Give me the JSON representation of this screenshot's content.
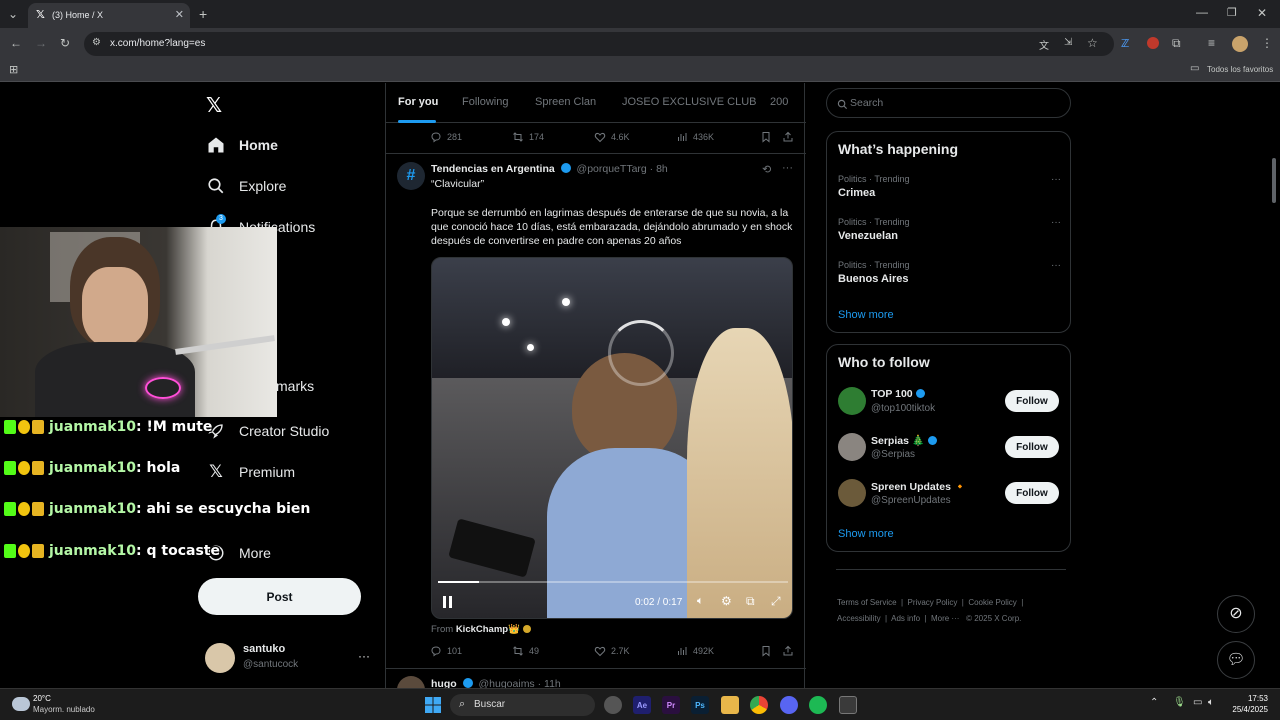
{
  "browser": {
    "tab_title": "(3) Home / X",
    "url": "x.com/home?lang=es",
    "bookmarks_label": "Todos los favoritos"
  },
  "nav": {
    "home": "Home",
    "explore": "Explore",
    "notifications": "Notifications",
    "bookmarks_partial": "marks",
    "creator_studio": "Creator Studio",
    "premium": "Premium",
    "more": "More",
    "post": "Post",
    "notif_badge": "3"
  },
  "account": {
    "name": "santuko",
    "handle": "@santucock"
  },
  "feed_tabs": [
    "For you",
    "Following",
    "Spreen Clan",
    "JOSEO EXCLUSIVE CLUB",
    "200"
  ],
  "prev_post_actions": {
    "replies": "281",
    "reposts": "174",
    "likes": "4.6K",
    "views": "436K"
  },
  "post": {
    "author": "Tendencias en Argentina",
    "handle": "@porqueTTarg",
    "time": "· 8h",
    "subtitle": "“Clavicular”",
    "text": "Porque se derrumbó en lagrimas después de enterarse de que su novia, a la que conoció hace 10 días, está embarazada, dejándolo abrumado y en shock después de convertirse en padre con apenas 20 años",
    "video_time": "0:02 / 0:17",
    "from_label": "From",
    "from_source": "KickChamp👑",
    "replies": "101",
    "reposts": "49",
    "likes": "2.7K",
    "views": "492K"
  },
  "next_post": {
    "author": "hugo",
    "handle": "@hugoaims",
    "time": "· 11h"
  },
  "search_placeholder": "Search",
  "trending": {
    "title": "What’s happening",
    "items": [
      {
        "meta": "Politics · Trending",
        "name": "Crimea"
      },
      {
        "meta": "Politics · Trending",
        "name": "Venezuelan"
      },
      {
        "meta": "Politics · Trending",
        "name": "Buenos Aires"
      }
    ],
    "show_more": "Show more"
  },
  "who_to_follow": {
    "title": "Who to follow",
    "items": [
      {
        "name": "TOP 100",
        "handle": "@top100tiktok",
        "button": "Follow"
      },
      {
        "name": "Serpias 🎄",
        "handle": "@Serpias",
        "button": "Follow"
      },
      {
        "name": "Spreen Updates 🔸",
        "handle": "@SpreenUpdates",
        "button": "Follow"
      }
    ],
    "show_more": "Show more"
  },
  "footer_links": [
    "Terms of Service",
    "Privacy Policy",
    "Cookie Policy",
    "Accessibility",
    "Ads info",
    "More ···",
    "© 2025 X Corp."
  ],
  "chat": [
    {
      "user": "juanmak10",
      "message": ": !M mute"
    },
    {
      "user": "juanmak10",
      "message": ": hola"
    },
    {
      "user": "juanmak10",
      "message": ": ahi se escuycha bien"
    },
    {
      "user": "juanmak10",
      "message": ": q tocaste"
    }
  ],
  "taskbar": {
    "weather_temp": "20°C",
    "weather_desc": "Mayorm. nublado",
    "search": "Buscar",
    "time": "17:53",
    "date": "25/4/2025"
  },
  "colors": {
    "accent": "#1d9bf0",
    "text": "#e7e9ea",
    "muted": "#71767b",
    "border": "#2f3336"
  }
}
